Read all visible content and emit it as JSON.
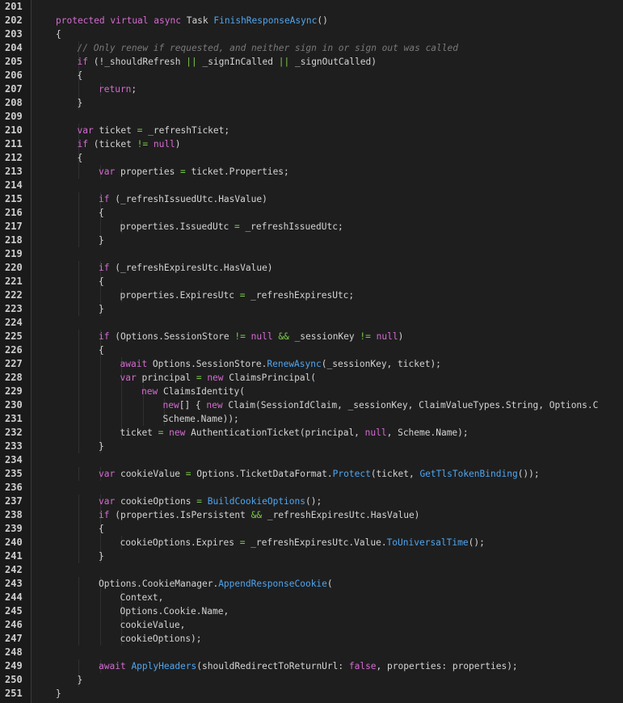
{
  "editor": {
    "language": "C#",
    "colors": {
      "background": "#1e1e1e",
      "gutter": "#1a1a1a",
      "line_number": "#cfcfcf",
      "text": "#d4d4d4",
      "keyword": "#d46bd0",
      "method": "#4fa6f0",
      "operator": "#7ccc4a",
      "comment": "#7a7a7a"
    },
    "lines": [
      {
        "num": "201",
        "indent": 0,
        "tokens": []
      },
      {
        "num": "202",
        "indent": 2,
        "tokens": [
          [
            "kw",
            "protected"
          ],
          [
            "t",
            " "
          ],
          [
            "kw",
            "virtual"
          ],
          [
            "t",
            " "
          ],
          [
            "kw",
            "async"
          ],
          [
            "t",
            " Task "
          ],
          [
            "mt",
            "FinishResponseAsync"
          ],
          [
            "t",
            "()"
          ]
        ]
      },
      {
        "num": "203",
        "indent": 2,
        "tokens": [
          [
            "t",
            "{"
          ]
        ]
      },
      {
        "num": "204",
        "indent": 3,
        "tokens": [
          [
            "cm",
            "// Only renew if requested, and neither sign in or sign out was called"
          ]
        ]
      },
      {
        "num": "205",
        "indent": 3,
        "tokens": [
          [
            "kw",
            "if"
          ],
          [
            "t",
            " (!_shouldRefresh "
          ],
          [
            "op",
            "||"
          ],
          [
            "t",
            " _signInCalled "
          ],
          [
            "op",
            "||"
          ],
          [
            "t",
            " _signOutCalled)"
          ]
        ]
      },
      {
        "num": "206",
        "indent": 3,
        "tokens": [
          [
            "t",
            "{"
          ]
        ]
      },
      {
        "num": "207",
        "indent": 4,
        "tokens": [
          [
            "kw",
            "return"
          ],
          [
            "t",
            ";"
          ]
        ]
      },
      {
        "num": "208",
        "indent": 3,
        "tokens": [
          [
            "t",
            "}"
          ]
        ]
      },
      {
        "num": "209",
        "indent": 0,
        "tokens": []
      },
      {
        "num": "210",
        "indent": 3,
        "tokens": [
          [
            "kw",
            "var"
          ],
          [
            "t",
            " ticket "
          ],
          [
            "op",
            "="
          ],
          [
            "t",
            " _refreshTicket;"
          ]
        ]
      },
      {
        "num": "211",
        "indent": 3,
        "tokens": [
          [
            "kw",
            "if"
          ],
          [
            "t",
            " (ticket "
          ],
          [
            "op",
            "!="
          ],
          [
            "t",
            " "
          ],
          [
            "kw",
            "null"
          ],
          [
            "t",
            ")"
          ]
        ]
      },
      {
        "num": "212",
        "indent": 3,
        "tokens": [
          [
            "t",
            "{"
          ]
        ]
      },
      {
        "num": "213",
        "indent": 4,
        "tokens": [
          [
            "kw",
            "var"
          ],
          [
            "t",
            " properties "
          ],
          [
            "op",
            "="
          ],
          [
            "t",
            " ticket.Properties;"
          ]
        ]
      },
      {
        "num": "214",
        "indent": 0,
        "tokens": []
      },
      {
        "num": "215",
        "indent": 4,
        "tokens": [
          [
            "kw",
            "if"
          ],
          [
            "t",
            " (_refreshIssuedUtc.HasValue)"
          ]
        ]
      },
      {
        "num": "216",
        "indent": 4,
        "tokens": [
          [
            "t",
            "{"
          ]
        ]
      },
      {
        "num": "217",
        "indent": 5,
        "tokens": [
          [
            "t",
            "properties.IssuedUtc "
          ],
          [
            "op",
            "="
          ],
          [
            "t",
            " _refreshIssuedUtc;"
          ]
        ]
      },
      {
        "num": "218",
        "indent": 4,
        "tokens": [
          [
            "t",
            "}"
          ]
        ]
      },
      {
        "num": "219",
        "indent": 0,
        "tokens": []
      },
      {
        "num": "220",
        "indent": 4,
        "tokens": [
          [
            "kw",
            "if"
          ],
          [
            "t",
            " (_refreshExpiresUtc.HasValue)"
          ]
        ]
      },
      {
        "num": "221",
        "indent": 4,
        "tokens": [
          [
            "t",
            "{"
          ]
        ]
      },
      {
        "num": "222",
        "indent": 5,
        "tokens": [
          [
            "t",
            "properties.ExpiresUtc "
          ],
          [
            "op",
            "="
          ],
          [
            "t",
            " _refreshExpiresUtc;"
          ]
        ]
      },
      {
        "num": "223",
        "indent": 4,
        "tokens": [
          [
            "t",
            "}"
          ]
        ]
      },
      {
        "num": "224",
        "indent": 0,
        "tokens": []
      },
      {
        "num": "225",
        "indent": 4,
        "tokens": [
          [
            "kw",
            "if"
          ],
          [
            "t",
            " (Options.SessionStore "
          ],
          [
            "op",
            "!="
          ],
          [
            "t",
            " "
          ],
          [
            "kw",
            "null"
          ],
          [
            "t",
            " "
          ],
          [
            "op",
            "&&"
          ],
          [
            "t",
            " _sessionKey "
          ],
          [
            "op",
            "!="
          ],
          [
            "t",
            " "
          ],
          [
            "kw",
            "null"
          ],
          [
            "t",
            ")"
          ]
        ]
      },
      {
        "num": "226",
        "indent": 4,
        "tokens": [
          [
            "t",
            "{"
          ]
        ]
      },
      {
        "num": "227",
        "indent": 5,
        "tokens": [
          [
            "kw",
            "await"
          ],
          [
            "t",
            " Options.SessionStore."
          ],
          [
            "mt",
            "RenewAsync"
          ],
          [
            "t",
            "(_sessionKey, ticket);"
          ]
        ]
      },
      {
        "num": "228",
        "indent": 5,
        "tokens": [
          [
            "kw",
            "var"
          ],
          [
            "t",
            " principal "
          ],
          [
            "op",
            "="
          ],
          [
            "t",
            " "
          ],
          [
            "kw",
            "new"
          ],
          [
            "t",
            " ClaimsPrincipal("
          ]
        ]
      },
      {
        "num": "229",
        "indent": 6,
        "tokens": [
          [
            "kw",
            "new"
          ],
          [
            "t",
            " ClaimsIdentity("
          ]
        ]
      },
      {
        "num": "230",
        "indent": 7,
        "tokens": [
          [
            "kw",
            "new"
          ],
          [
            "t",
            "[] { "
          ],
          [
            "kw",
            "new"
          ],
          [
            "t",
            " Claim(SessionIdClaim, _sessionKey, ClaimValueTypes.String, Options.C"
          ]
        ]
      },
      {
        "num": "231",
        "indent": 7,
        "tokens": [
          [
            "t",
            "Scheme.Name));"
          ]
        ]
      },
      {
        "num": "232",
        "indent": 5,
        "tokens": [
          [
            "t",
            "ticket "
          ],
          [
            "op",
            "="
          ],
          [
            "t",
            " "
          ],
          [
            "kw",
            "new"
          ],
          [
            "t",
            " AuthenticationTicket(principal, "
          ],
          [
            "kw",
            "null"
          ],
          [
            "t",
            ", Scheme.Name);"
          ]
        ]
      },
      {
        "num": "233",
        "indent": 4,
        "tokens": [
          [
            "t",
            "}"
          ]
        ]
      },
      {
        "num": "234",
        "indent": 0,
        "tokens": []
      },
      {
        "num": "235",
        "indent": 4,
        "tokens": [
          [
            "kw",
            "var"
          ],
          [
            "t",
            " cookieValue "
          ],
          [
            "op",
            "="
          ],
          [
            "t",
            " Options.TicketDataFormat."
          ],
          [
            "mt",
            "Protect"
          ],
          [
            "t",
            "(ticket, "
          ],
          [
            "mt",
            "GetTlsTokenBinding"
          ],
          [
            "t",
            "());"
          ]
        ]
      },
      {
        "num": "236",
        "indent": 0,
        "tokens": []
      },
      {
        "num": "237",
        "indent": 4,
        "tokens": [
          [
            "kw",
            "var"
          ],
          [
            "t",
            " cookieOptions "
          ],
          [
            "op",
            "="
          ],
          [
            "t",
            " "
          ],
          [
            "mt",
            "BuildCookieOptions"
          ],
          [
            "t",
            "();"
          ]
        ]
      },
      {
        "num": "238",
        "indent": 4,
        "tokens": [
          [
            "kw",
            "if"
          ],
          [
            "t",
            " (properties.IsPersistent "
          ],
          [
            "op",
            "&&"
          ],
          [
            "t",
            " _refreshExpiresUtc.HasValue)"
          ]
        ]
      },
      {
        "num": "239",
        "indent": 4,
        "tokens": [
          [
            "t",
            "{"
          ]
        ]
      },
      {
        "num": "240",
        "indent": 5,
        "tokens": [
          [
            "t",
            "cookieOptions.Expires "
          ],
          [
            "op",
            "="
          ],
          [
            "t",
            " _refreshExpiresUtc.Value."
          ],
          [
            "mt",
            "ToUniversalTime"
          ],
          [
            "t",
            "();"
          ]
        ]
      },
      {
        "num": "241",
        "indent": 4,
        "tokens": [
          [
            "t",
            "}"
          ]
        ]
      },
      {
        "num": "242",
        "indent": 0,
        "tokens": []
      },
      {
        "num": "243",
        "indent": 4,
        "tokens": [
          [
            "t",
            "Options.CookieManager."
          ],
          [
            "mt",
            "AppendResponseCookie"
          ],
          [
            "t",
            "("
          ]
        ]
      },
      {
        "num": "244",
        "indent": 5,
        "tokens": [
          [
            "t",
            "Context,"
          ]
        ]
      },
      {
        "num": "245",
        "indent": 5,
        "tokens": [
          [
            "t",
            "Options.Cookie.Name,"
          ]
        ]
      },
      {
        "num": "246",
        "indent": 5,
        "tokens": [
          [
            "t",
            "cookieValue,"
          ]
        ]
      },
      {
        "num": "247",
        "indent": 5,
        "tokens": [
          [
            "t",
            "cookieOptions);"
          ]
        ]
      },
      {
        "num": "248",
        "indent": 0,
        "tokens": []
      },
      {
        "num": "249",
        "indent": 4,
        "tokens": [
          [
            "kw",
            "await"
          ],
          [
            "t",
            " "
          ],
          [
            "mt",
            "ApplyHeaders"
          ],
          [
            "t",
            "(shouldRedirectToReturnUrl: "
          ],
          [
            "kw",
            "false"
          ],
          [
            "t",
            ", properties: properties);"
          ]
        ]
      },
      {
        "num": "250",
        "indent": 3,
        "tokens": [
          [
            "t",
            "}"
          ]
        ]
      },
      {
        "num": "251",
        "indent": 2,
        "tokens": [
          [
            "t",
            "}"
          ]
        ]
      }
    ]
  }
}
